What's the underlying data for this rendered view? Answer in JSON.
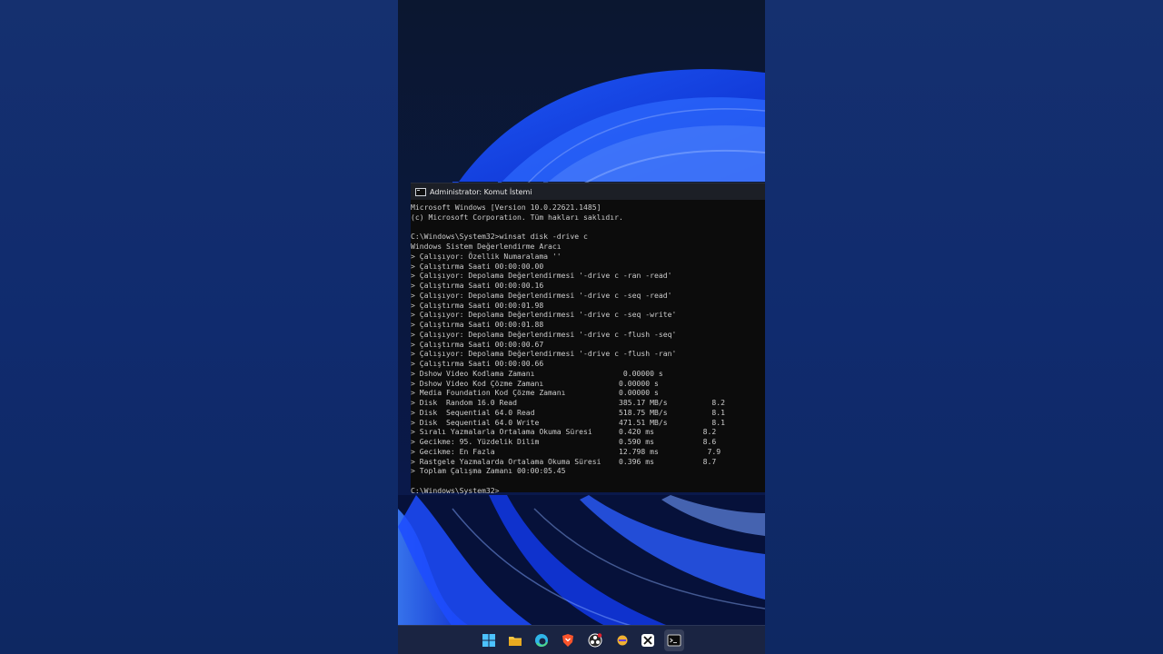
{
  "window": {
    "title": "Administrator: Komut İstemi"
  },
  "terminal": {
    "lines": [
      "Microsoft Windows [Version 10.0.22621.1485]",
      "(c) Microsoft Corporation. Tüm hakları saklıdır.",
      "",
      "C:\\Windows\\System32>winsat disk -drive c",
      "Windows Sistem Değerlendirme Aracı",
      "> Çalışıyor: Özellik Numaralama ''",
      "> Çalıştırma Saati 00:00:00.00",
      "> Çalışıyor: Depolama Değerlendirmesi '-drive c -ran -read'",
      "> Çalıştırma Saati 00:00:00.16",
      "> Çalışıyor: Depolama Değerlendirmesi '-drive c -seq -read'",
      "> Çalıştırma Saati 00:00:01.98",
      "> Çalışıyor: Depolama Değerlendirmesi '-drive c -seq -write'",
      "> Çalıştırma Saati 00:00:01.88",
      "> Çalışıyor: Depolama Değerlendirmesi '-drive c -flush -seq'",
      "> Çalıştırma Saati 00:00:00.67",
      "> Çalışıyor: Depolama Değerlendirmesi '-drive c -flush -ran'",
      "> Çalıştırma Saati 00:00:00.66",
      "> Dshow Video Kodlama Zamanı                    0.00000 s",
      "> Dshow Video Kod Çözme Zamanı                 0.00000 s",
      "> Media Foundation Kod Çözme Zamanı            0.00000 s",
      "> Disk  Random 16.0 Read                       385.17 MB/s          8.2",
      "> Disk  Sequential 64.0 Read                   518.75 MB/s          8.1",
      "> Disk  Sequential 64.0 Write                  471.51 MB/s          8.1",
      "> Sıralı Yazmalarla Ortalama Okuma Süresi      0.420 ms           8.2",
      "> Gecikme: 95. Yüzdelik Dilim                  0.590 ms           8.6",
      "> Gecikme: En Fazla                            12.798 ms           7.9",
      "> Rastgele Yazmalarda Ortalama Okuma Süresi    0.396 ms           8.7",
      "> Toplam Çalışma Zamanı 00:00:05.45",
      "",
      "C:\\Windows\\System32>"
    ]
  },
  "taskbar": {
    "icons": [
      {
        "name": "windows-start-icon",
        "color": "#4cc2ff"
      },
      {
        "name": "file-explorer-icon",
        "color": "#f5c542"
      },
      {
        "name": "edge-browser-icon",
        "color": "#2fb5e8"
      },
      {
        "name": "brave-browser-icon",
        "color": "#fb542b"
      },
      {
        "name": "obs-studio-icon",
        "color": "#ffffff"
      },
      {
        "name": "app-icon",
        "color": "#f0b132"
      },
      {
        "name": "capcut-icon",
        "color": "#ffffff"
      },
      {
        "name": "terminal-icon",
        "color": "#cccccc"
      }
    ]
  }
}
